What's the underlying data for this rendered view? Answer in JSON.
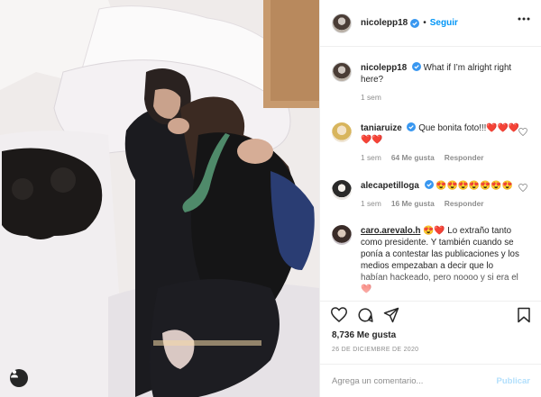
{
  "post": {
    "author": "nicolepp18",
    "follow_label": "Seguir",
    "separator": "•",
    "caption": {
      "username": "nicolepp18",
      "text": "What if I’m alright right here?",
      "time": "1 sem"
    },
    "comments": [
      {
        "username": "taniaruize",
        "verified": true,
        "text": "Que bonita foto!!!❤️❤️❤️❤️❤️",
        "time": "1 sem",
        "likes": "64 Me gusta",
        "reply_label": "Responder"
      },
      {
        "username": "alecapetilloga",
        "verified": true,
        "text": "😍😍😍😍😍😍😍",
        "time": "1 sem",
        "likes": "16 Me gusta",
        "reply_label": "Responder"
      },
      {
        "username": "caro.arevalo.h",
        "verified": false,
        "text": "😍❤️ Lo extraño tanto como presidente. Y también cuando se ponía a contestar las publicaciones y los medios empezaban a decir que lo habían hackeado, pero noooo y si era el❤️",
        "time": "",
        "likes": "",
        "reply_label": ""
      }
    ],
    "likes_count": "8,736 Me gusta",
    "date": "26 DE DICIEMBRE DE 2020",
    "comment_placeholder": "Agrega un comentario...",
    "publish_label": "Publicar"
  },
  "colors": {
    "link_blue": "#0095f6",
    "publish_disabled": "#b2dffc",
    "muted_text": "#8e8e8e",
    "verified_badge": "#3897f0",
    "text": "#262626"
  },
  "icons": {
    "more": "more-horizontal-icon",
    "verified": "verified-badge-icon",
    "like": "heart-icon",
    "comment": "comment-bubble-icon",
    "share": "paper-plane-icon",
    "save": "bookmark-icon",
    "user_tag": "user-tag-icon"
  }
}
